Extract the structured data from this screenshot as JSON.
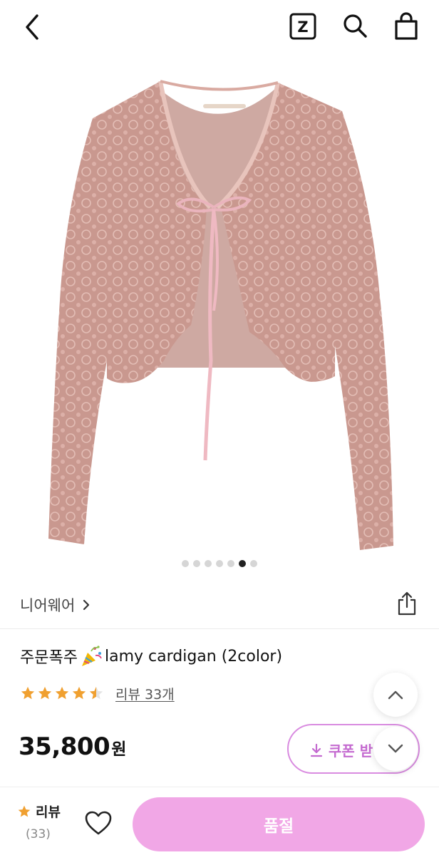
{
  "header": {
    "back_icon": "chevron-left-icon",
    "z_label": "Z",
    "search_icon": "search-icon",
    "cart_icon": "shopping-bag-icon"
  },
  "gallery": {
    "image_alt": "pink lace cardigan with ribbon tie",
    "total": 7,
    "active_index": 5
  },
  "brand": {
    "name": "니어웨어",
    "share_icon": "share-icon"
  },
  "product": {
    "title_prefix": "주문폭주",
    "title_emoji": "party-popper-icon",
    "title_name": "lamy cardigan (2color)",
    "rating": 4.5,
    "review_link": "리뷰 33개",
    "price_number": "35,800",
    "price_unit": "원"
  },
  "coupon": {
    "label": "쿠폰 받",
    "icon": "download-icon",
    "color": "#c46ad0"
  },
  "bottom": {
    "review_label": "리뷰",
    "review_count": "(33)",
    "heart_icon": "heart-icon",
    "soldout_label": "품절",
    "soldout_color": "#f1a7e6"
  },
  "colors": {
    "star": "#f0a030",
    "accent": "#d98be0"
  }
}
